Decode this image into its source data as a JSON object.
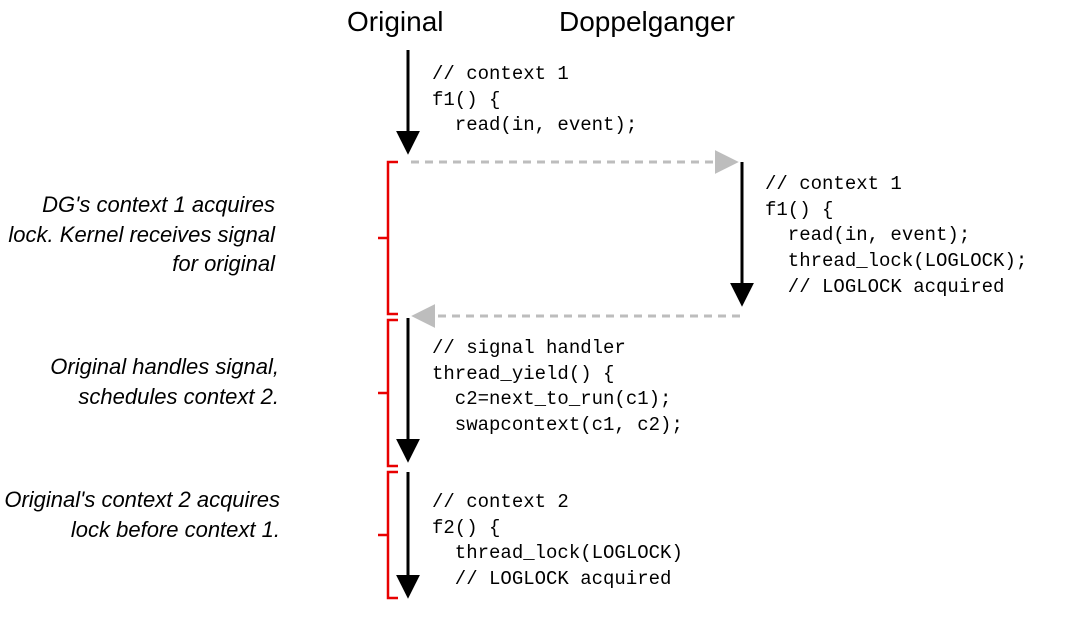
{
  "headings": {
    "original": "Original",
    "doppelganger": "Doppelganger"
  },
  "annotations": {
    "a1": "DG's context 1 acquires\nlock. Kernel receives\nsignal for original",
    "a2": "Original handles signal,\nschedules context 2.",
    "a3": "Original's context 2\nacquires lock before\ncontext 1."
  },
  "code": {
    "c1": "// context 1\nf1() {\n  read(in, event);",
    "c2": "// context 1\nf1() {\n  read(in, event);\n  thread_lock(LOGLOCK);\n  // LOGLOCK acquired",
    "c3": "// signal handler\nthread_yield() {\n  c2=next_to_run(c1);\n  swapcontext(c1, c2);",
    "c4": "// context 2\nf2() {\n  thread_lock(LOGLOCK)\n  // LOGLOCK acquired"
  }
}
